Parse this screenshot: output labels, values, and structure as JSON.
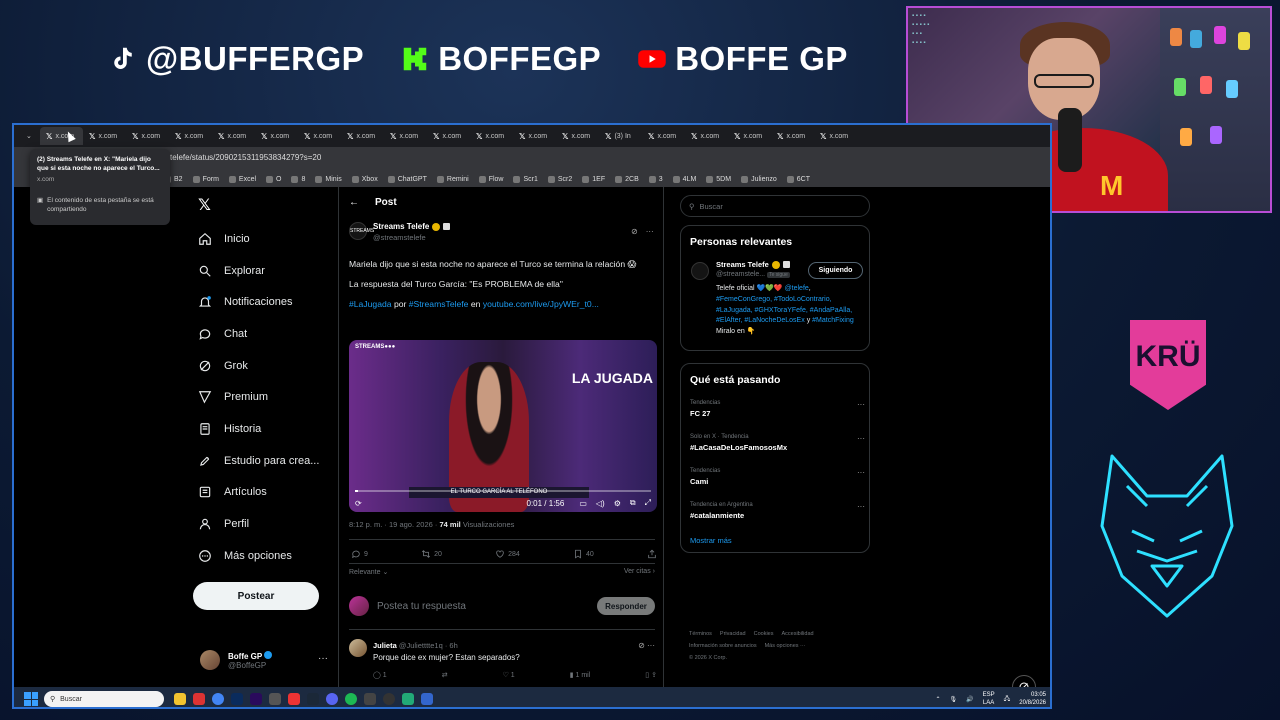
{
  "overlay": {
    "socials": [
      {
        "platform": "tiktok",
        "handle": "@BUFFERGP",
        "icon": "tiktok-icon",
        "color": "#ffffff"
      },
      {
        "platform": "kick",
        "handle": "BOFFEGP",
        "icon": "kick-icon",
        "color": "#53fc18"
      },
      {
        "platform": "youtube",
        "handle": "BOFFE GP",
        "icon": "youtube-icon",
        "color": "#ff0000"
      }
    ],
    "sponsor": "KRÜ",
    "webcam_border_color": "#b84dd6"
  },
  "browser": {
    "tabs": [
      "x.com",
      "x.com",
      "x.com",
      "x.com",
      "x.com",
      "x.com",
      "x.com",
      "x.com",
      "x.com",
      "x.com",
      "x.com",
      "x.com",
      "x.com",
      "(3) In",
      "x.com",
      "x.com",
      "x.com",
      "x.com",
      "x.com"
    ],
    "url": "telefe/status/2090215311953834279?s=20",
    "bookmarks": [
      "B2",
      "Form",
      "Excel",
      "O",
      "8",
      "Minis",
      "Xbox",
      "ChatGPT",
      "Remini",
      "Flow",
      "Scr1",
      "Scr2",
      "1EF",
      "2CB",
      "3",
      "4LM",
      "5DM",
      "Julienzo",
      "6CT"
    ],
    "tooltip": {
      "title": "(2) Streams Telefe en X: \"Mariela dijo que si esta noche no aparece el Turco...",
      "domain": "x.com",
      "sharing": "El contenido de esta pestaña se está compartiendo"
    }
  },
  "nav": {
    "items": [
      {
        "label": "Inicio",
        "icon": "home-icon"
      },
      {
        "label": "Explorar",
        "icon": "search-icon"
      },
      {
        "label": "Notificaciones",
        "icon": "bell-icon"
      },
      {
        "label": "Chat",
        "icon": "chat-icon"
      },
      {
        "label": "Grok",
        "icon": "grok-icon"
      },
      {
        "label": "Premium",
        "icon": "premium-icon"
      },
      {
        "label": "Historia",
        "icon": "history-icon"
      },
      {
        "label": "Estudio para crea...",
        "icon": "rocket-icon"
      },
      {
        "label": "Artículos",
        "icon": "article-icon"
      },
      {
        "label": "Perfil",
        "icon": "profile-icon"
      },
      {
        "label": "Más opciones",
        "icon": "more-options-icon"
      }
    ],
    "post_button": "Postear",
    "account": {
      "name": "Boffe GP",
      "handle": "@BoffeGP"
    }
  },
  "post": {
    "header": "Post",
    "author": {
      "name": "Streams Telefe",
      "handle": "@streamstelefe",
      "avatar_text": "STREAMS"
    },
    "text1": "Mariela dijo que si esta noche no aparece el Turco se termina la relación 😱",
    "text2": "La respuesta del Turco García: \"Es PROBLEMA de ella\"",
    "hashtag": "#LaJugada",
    "por": "por",
    "mention": "#StreamsTelefe",
    "en": "en",
    "video_link": "youtube.com/live/JpyWEr_t0...",
    "video": {
      "logo": "STREAMS●●●",
      "show": "LA JUGADA",
      "ticker": "EL TURCO GARCÍA AL TELÉFONO",
      "time": "0:01 / 1:56",
      "progress": 0.01
    },
    "meta": {
      "time": "8:12 p. m. · 19 ago. 2026 ·",
      "views": "74 mil",
      "views_label": "Visualizaciones"
    },
    "stats": {
      "replies": "9",
      "reposts": "20",
      "likes": "284",
      "bookmarks": "40"
    },
    "sort": "Relevante",
    "quotes": "Ver citas",
    "reply_placeholder": "Postea tu respuesta",
    "reply_button": "Responder"
  },
  "comment": {
    "name": "Julieta",
    "handle": "@Julietttte1q · 6h",
    "text": "Porque dice ex mujer? Estan separados?",
    "replies": "1",
    "reposts": "",
    "likes": "1",
    "views": "1 mil"
  },
  "sidebar": {
    "search_placeholder": "Buscar",
    "relevant_title": "Personas relevantes",
    "relevant": {
      "name": "Streams Telefe",
      "handle": "@streamstele...",
      "follows_you": "Te sigue",
      "button": "Siguiendo",
      "bio_start": "Telefe oficial 💙💚❤️ ",
      "bio_mention": "@telefe",
      "bio_tags1": "#FemeConGrego, #TodoLoContrario, #LaJugada, #GHXToraYFefe, #AndaPaAlla, #ElAfter, #LaNocheDeLosEx",
      "bio_y": "y",
      "bio_tags2": "#MatchFixing",
      "bio_end": "Miralo en 👇"
    },
    "trends_title": "Qué está pasando",
    "trends": [
      {
        "context": "Tendencias",
        "name": "FC 27"
      },
      {
        "context": "Solo en X · Tendencia",
        "name": "#LaCasaDeLosFamososMx"
      },
      {
        "context": "Tendencias",
        "name": "Cami"
      },
      {
        "context": "Tendencia en Argentina",
        "name": "#catalanmiente"
      }
    ],
    "show_more": "Mostrar más",
    "footer": [
      "Términos",
      "Privacidad",
      "Cookies",
      "Accesibilidad",
      "Información sobre anuncios",
      "Más opciones ···",
      "© 2026 X Corp."
    ]
  },
  "taskbar": {
    "search_placeholder": "Buscar",
    "lang": "ESP",
    "lang2": "LAA",
    "time": "03:05",
    "date": "20/8/2026"
  }
}
